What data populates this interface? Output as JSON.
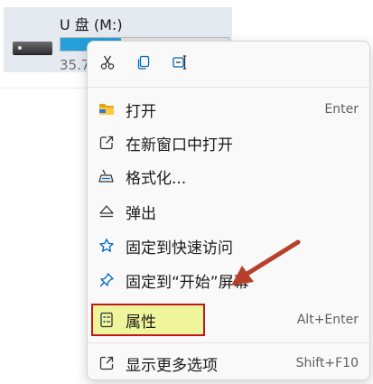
{
  "drive": {
    "name": "U 盘 (M:)",
    "size_text": "35.7",
    "usage_fraction": 0.36,
    "icon": "usb-drive-icon"
  },
  "quick_actions": [
    {
      "icon": "cut-icon"
    },
    {
      "icon": "copy-icon"
    },
    {
      "icon": "rename-icon"
    }
  ],
  "menu": {
    "items": [
      {
        "label": "打开",
        "shortcut": "Enter",
        "icon": "folder-icon"
      },
      {
        "label": "在新窗口中打开",
        "shortcut": "",
        "icon": "open-new-window-icon"
      },
      {
        "label": "格式化...",
        "shortcut": "",
        "icon": "format-icon"
      },
      {
        "label": "弹出",
        "shortcut": "",
        "icon": "eject-icon"
      },
      {
        "label": "固定到快速访问",
        "shortcut": "",
        "icon": "star-icon"
      },
      {
        "label": "固定到“开始”屏幕",
        "shortcut": "",
        "icon": "pin-icon"
      },
      {
        "label": "属性",
        "shortcut": "Alt+Enter",
        "icon": "properties-icon"
      },
      {
        "label": "显示更多选项",
        "shortcut": "Shift+F10",
        "icon": "more-options-icon"
      }
    ]
  },
  "annotations": {
    "highlight_color": "#eef59a",
    "border_color": "#c4161c",
    "arrow_color": "#b8402a"
  }
}
